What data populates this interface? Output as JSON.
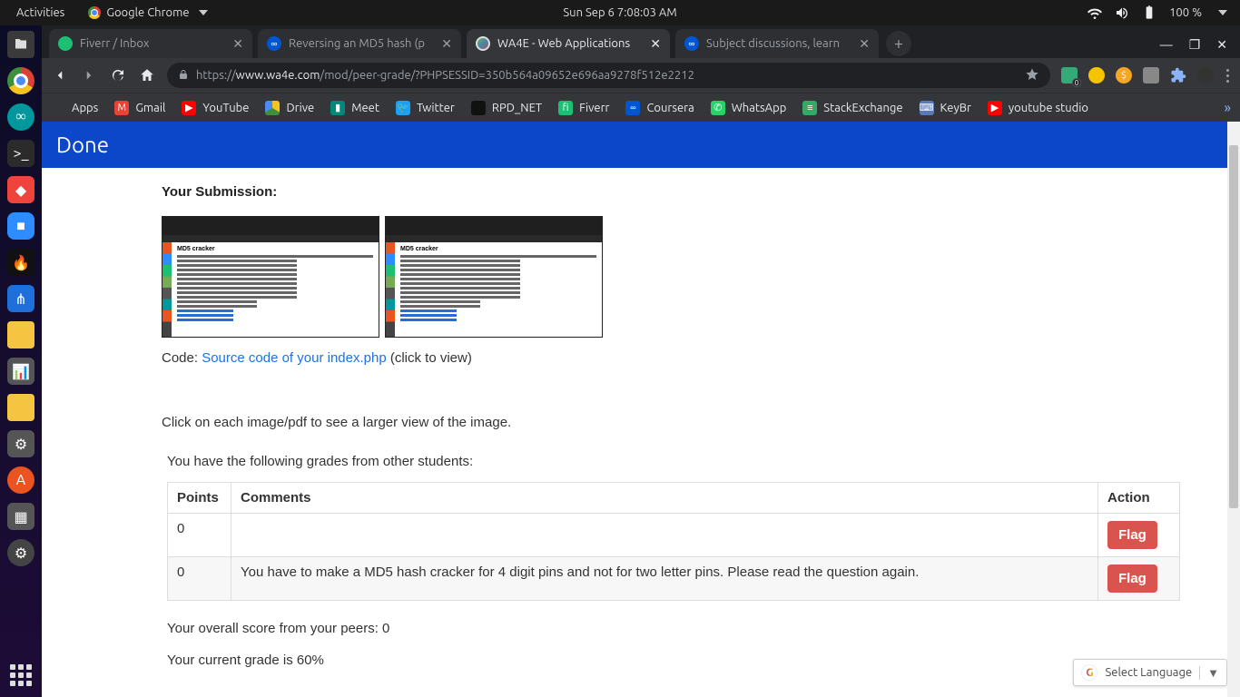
{
  "topbar": {
    "activities": "Activities",
    "browser": "Google Chrome",
    "datetime": "Sun Sep 6   7:08:03 AM",
    "battery": "100 %"
  },
  "tabs": [
    {
      "title": "Fiverr / Inbox"
    },
    {
      "title": "Reversing an MD5 hash (p"
    },
    {
      "title": "WA4E - Web Applications"
    },
    {
      "title": "Subject discussions, learn"
    }
  ],
  "url": {
    "scheme": "https://",
    "host": "www.wa4e.com",
    "path": "/mod/peer-grade/?PHPSESSID=350b564a09652e696aa9278f512e2212"
  },
  "bookmarks": {
    "apps": "Apps",
    "gmail": "Gmail",
    "youtube": "YouTube",
    "drive": "Drive",
    "meet": "Meet",
    "twitter": "Twitter",
    "rpd": "RPD_NET",
    "fiverr": "Fiverr",
    "coursera": "Coursera",
    "whatsapp": "WhatsApp",
    "stackexchange": "StackExchange",
    "keybr": "KeyBr",
    "youtubestudio": "youtube studio"
  },
  "page": {
    "done": "Done",
    "your_submission": "Your Submission:",
    "thumb_title": "MD5 cracker",
    "code_prefix": "Code: ",
    "code_link": "Source code of your index.php",
    "code_suffix": " (click to view)",
    "hint": "Click on each image/pdf to see a larger view of the image.",
    "grades_intro": "You have the following grades from other students:",
    "headers": {
      "points": "Points",
      "comments": "Comments",
      "action": "Action"
    },
    "rows": [
      {
        "points": "0",
        "comments": "",
        "flag": "Flag"
      },
      {
        "points": "0",
        "comments": "You have to make a MD5 hash cracker for 4 digit pins and not for two letter pins. Please read the question again.",
        "flag": "Flag"
      }
    ],
    "overall": "Your overall score from your peers: 0",
    "current": "Your current grade is 60%"
  },
  "lang": {
    "label": "Select Language"
  }
}
